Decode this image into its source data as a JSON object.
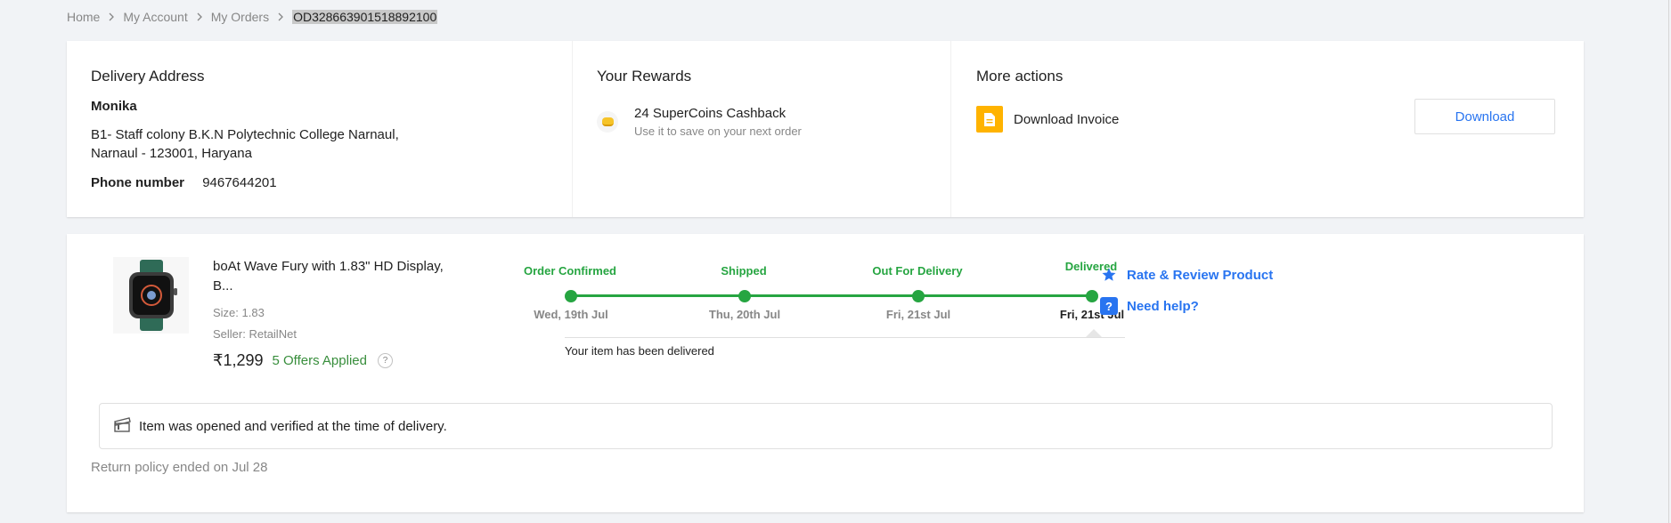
{
  "breadcrumb": {
    "items": [
      "Home",
      "My Account",
      "My Orders"
    ],
    "current": "OD328663901518892100"
  },
  "delivery": {
    "title": "Delivery Address",
    "name": "Monika",
    "address_line1": "B1- Staff colony B.K.N Polytechnic College Narnaul,",
    "address_line2": "Narnaul - 123001, Haryana",
    "phone_label": "Phone number",
    "phone": "9467644201"
  },
  "rewards": {
    "title": "Your Rewards",
    "coins_text": "24 SuperCoins Cashback",
    "coins_sub": "Use it to save on your next order"
  },
  "actions": {
    "title": "More actions",
    "invoice_label": "Download Invoice",
    "download_button": "Download"
  },
  "product": {
    "title_line1": "boAt Wave Fury with 1.83\" HD Display,",
    "title_line2": "B...",
    "size": "Size: 1.83",
    "seller": "Seller: RetailNet",
    "price": "₹1,299",
    "offers": "5 Offers Applied",
    "offer_help": "?"
  },
  "tracker": {
    "steps": [
      {
        "label": "Order Confirmed",
        "date": "Wed, 19th Jul"
      },
      {
        "label": "Shipped",
        "date": "Thu, 20th Jul"
      },
      {
        "label": "Out For Delivery",
        "date": "Fri, 21st Jul"
      },
      {
        "label": "Delivered",
        "date": "Fri, 21st Jul"
      }
    ],
    "status_note": "Your item has been delivered",
    "accent_color": "#26a541"
  },
  "side_links": {
    "rate": "Rate & Review Product",
    "help": "Need help?",
    "help_glyph": "?"
  },
  "verification": {
    "text": "Item was opened and verified at the time of delivery."
  },
  "return_policy": "Return policy ended on Jul 28",
  "colors": {
    "link": "#2874f0",
    "success": "#26a541",
    "invoice_icon": "#ffb300"
  }
}
